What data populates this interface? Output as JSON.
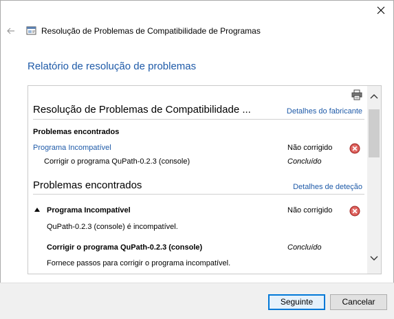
{
  "window": {
    "title": "Resolução de Problemas de Compatibilidade de Programas",
    "close_icon": "close-icon",
    "back_icon": "arrow-left-icon"
  },
  "page": {
    "heading": "Relatório de resolução de problemas"
  },
  "report": {
    "section1": {
      "title": "Resolução de Problemas de Compatibilidade ...",
      "link": "Detalhes do fabricante",
      "subheading": "Problemas encontrados",
      "issue_name": "Programa Incompatível",
      "issue_status": "Não corrigido",
      "fix_name": "Corrigir o programa QuPath-0.2.3 (console)",
      "fix_status": "Concluído"
    },
    "section2": {
      "title": "Problemas encontrados",
      "link": "Detalhes de deteção",
      "issue_name": "Programa Incompatível",
      "issue_status": "Não corrigido",
      "issue_desc": "QuPath-0.2.3 (console) é incompatível.",
      "fix_name": "Corrigir o programa QuPath-0.2.3 (console)",
      "fix_status": "Concluído",
      "fix_desc": "Fornece passos para corrigir o programa incompatível."
    }
  },
  "buttons": {
    "next": "Seguinte",
    "cancel": "Cancelar"
  },
  "colors": {
    "accent_link": "#1e5aa8",
    "error": "#c42b1c"
  }
}
